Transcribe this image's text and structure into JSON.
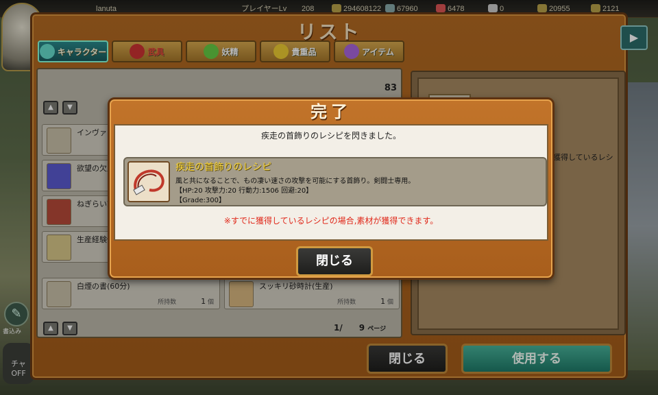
{
  "topbar": {
    "player_name": "lanuta",
    "player_label": "プレイヤーLv",
    "player_level": "208",
    "gold": "294608122",
    "card_count": "67960",
    "gem_count": "6478",
    "ticket_count": "0",
    "coin1": "20955",
    "coin2": "2121"
  },
  "list_window": {
    "title": "リスト",
    "tabs": [
      {
        "label": "キャラクター"
      },
      {
        "label": "武具"
      },
      {
        "label": "妖精"
      },
      {
        "label": "貴重品"
      },
      {
        "label": "アイテム"
      }
    ],
    "total_count": "83",
    "items": [
      {
        "name": "インヴァーク"
      },
      {
        "name": "欲望の欠片"
      },
      {
        "name": "ねぎらい証"
      },
      {
        "name": "生産経験値"
      },
      {
        "name": "白煙の書(60分)",
        "qty_label": "所持数",
        "qty": "1",
        "unit": "個"
      },
      {
        "name": "スッキリ砂時計(生産)",
        "qty_label": "所持数",
        "qty": "1",
        "unit": "個"
      }
    ],
    "page_current": "1/",
    "page_total": "9",
    "page_unit": "ページ",
    "right_desc": "獲得しているレシ",
    "close_label": "閉じる",
    "use_label": "使用する"
  },
  "side": {
    "pencil_label": "書込み",
    "chat_label": "チャ OFF"
  },
  "modal": {
    "title": "完了",
    "message": "疾走の首飾りのレシピを閃きました。",
    "recipe_name": "疾走の首飾りのレシピ",
    "recipe_desc": "風と共になることで、もの凄い速さの攻撃を可能にする首飾り。剣闘士専用。",
    "recipe_stats": "【HP:20 攻撃力:20 行動力:1506 回避:20】",
    "recipe_grade": "【Grade:300】",
    "note": "※すでに獲得しているレシピの場合,素材が獲得できます。",
    "close_label": "閉じる"
  }
}
